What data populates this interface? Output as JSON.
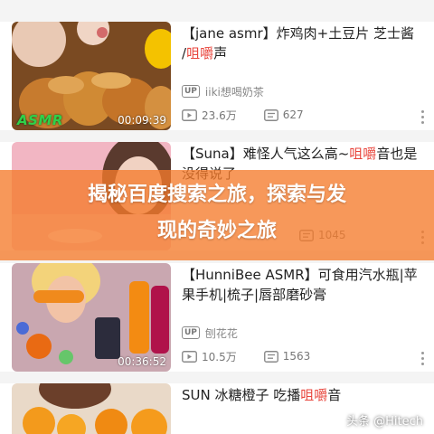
{
  "videos": [
    {
      "title_parts": [
        "【jane asmr】炸鸡肉+土豆片 芝士酱 /",
        "咀嚼",
        "声"
      ],
      "author": "iiki想喝奶茶",
      "views": "23.6万",
      "comments": "627",
      "duration": "00:09:39",
      "thumb_badge": "ASMR"
    },
    {
      "title_parts": [
        "【Suna】难怪人气这么高~",
        "咀嚼",
        "音也是没得说了"
      ],
      "author": "",
      "views": "",
      "comments": "1045",
      "duration": ""
    },
    {
      "title_parts": [
        "【HunniBee ASMR】可食用汽水瓶|苹果手机|梳子|唇部磨砂膏",
        "",
        ""
      ],
      "author": "刨花花",
      "views": "10.5万",
      "comments": "1563",
      "duration": "00:36:52"
    },
    {
      "title_parts": [
        "SUN 冰糖橙子 吃播",
        "咀嚼",
        "音"
      ],
      "author": "",
      "views": "",
      "comments": "",
      "duration": ""
    }
  ],
  "up_badge": "UP",
  "banner": {
    "line1": "揭秘百度搜索之旅，探索与发",
    "line2": "现的奇妙之旅"
  },
  "watermark": "头条 @Hitech",
  "colors": {
    "highlight": "#e8453c",
    "banner": "#f57b2b"
  }
}
